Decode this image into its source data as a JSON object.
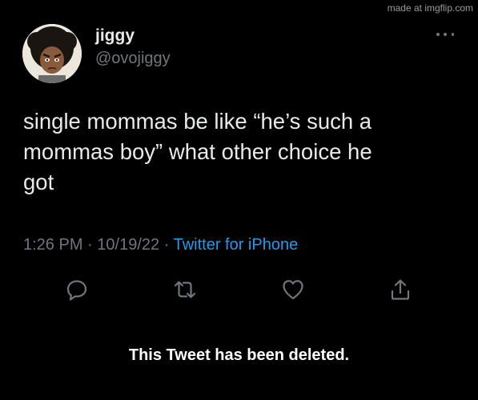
{
  "watermark": "made at imgflip.com",
  "tweet": {
    "author": {
      "display_name": "jiggy",
      "handle": "@ovojiggy",
      "avatar_icon": "cartoon-boy-avatar"
    },
    "text": "single mommas be like “he’s such a\nmommas boy” what other choice he\ngot",
    "time": "1:26 PM",
    "date": "10/19/22",
    "separator": "·",
    "source": "Twitter for iPhone",
    "actions": [
      {
        "name": "reply",
        "icon": "speech-bubble-icon"
      },
      {
        "name": "retweet",
        "icon": "retweet-arrows-icon"
      },
      {
        "name": "like",
        "icon": "heart-icon"
      },
      {
        "name": "share",
        "icon": "share-upload-icon"
      }
    ],
    "deleted_notice": "This Tweet has been deleted."
  },
  "colors": {
    "background": "#000000",
    "text_primary": "#e7e9ea",
    "text_secondary": "#71767b",
    "link": "#1d9bf0"
  }
}
